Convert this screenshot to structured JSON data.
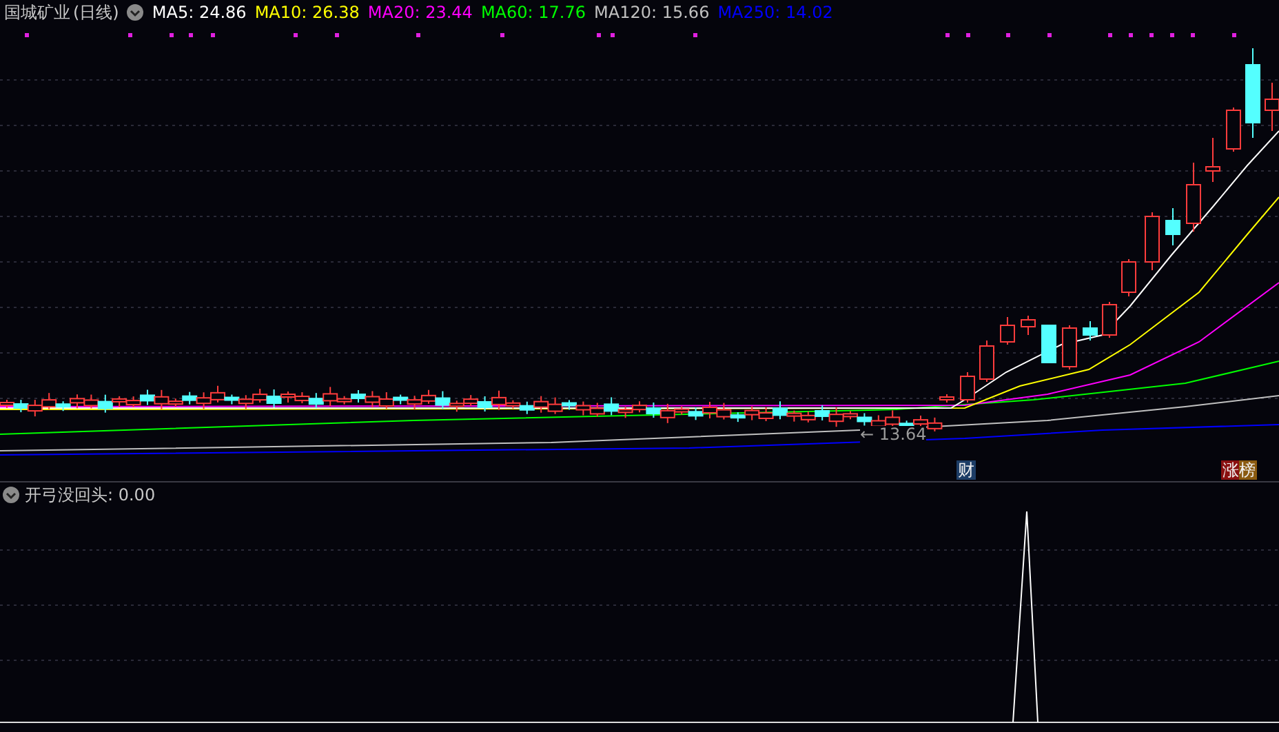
{
  "main_panel": {
    "stock_name": "国城矿业",
    "period": "(日线)",
    "indicators": [
      {
        "name": "MA5:",
        "value": "24.86",
        "color": "#ffffff"
      },
      {
        "name": "MA10:",
        "value": "26.38",
        "color": "#ffff00"
      },
      {
        "name": "MA20:",
        "value": "23.44",
        "color": "#ff00ff"
      },
      {
        "name": "MA60:",
        "value": "17.76",
        "color": "#00ff00"
      },
      {
        "name": "MA120:",
        "value": "15.66",
        "color": "#c0c0c0"
      },
      {
        "name": "MA250:",
        "value": "14.02",
        "color": "#0000ff"
      }
    ],
    "low_label": "← 13.64",
    "event_markers": [
      {
        "text": "财",
        "kind": "finance"
      },
      {
        "text": "涨榜",
        "kind": "rank"
      }
    ]
  },
  "indicator_panel": {
    "title": "开弓没回头",
    "value": ": 0.00"
  }
}
